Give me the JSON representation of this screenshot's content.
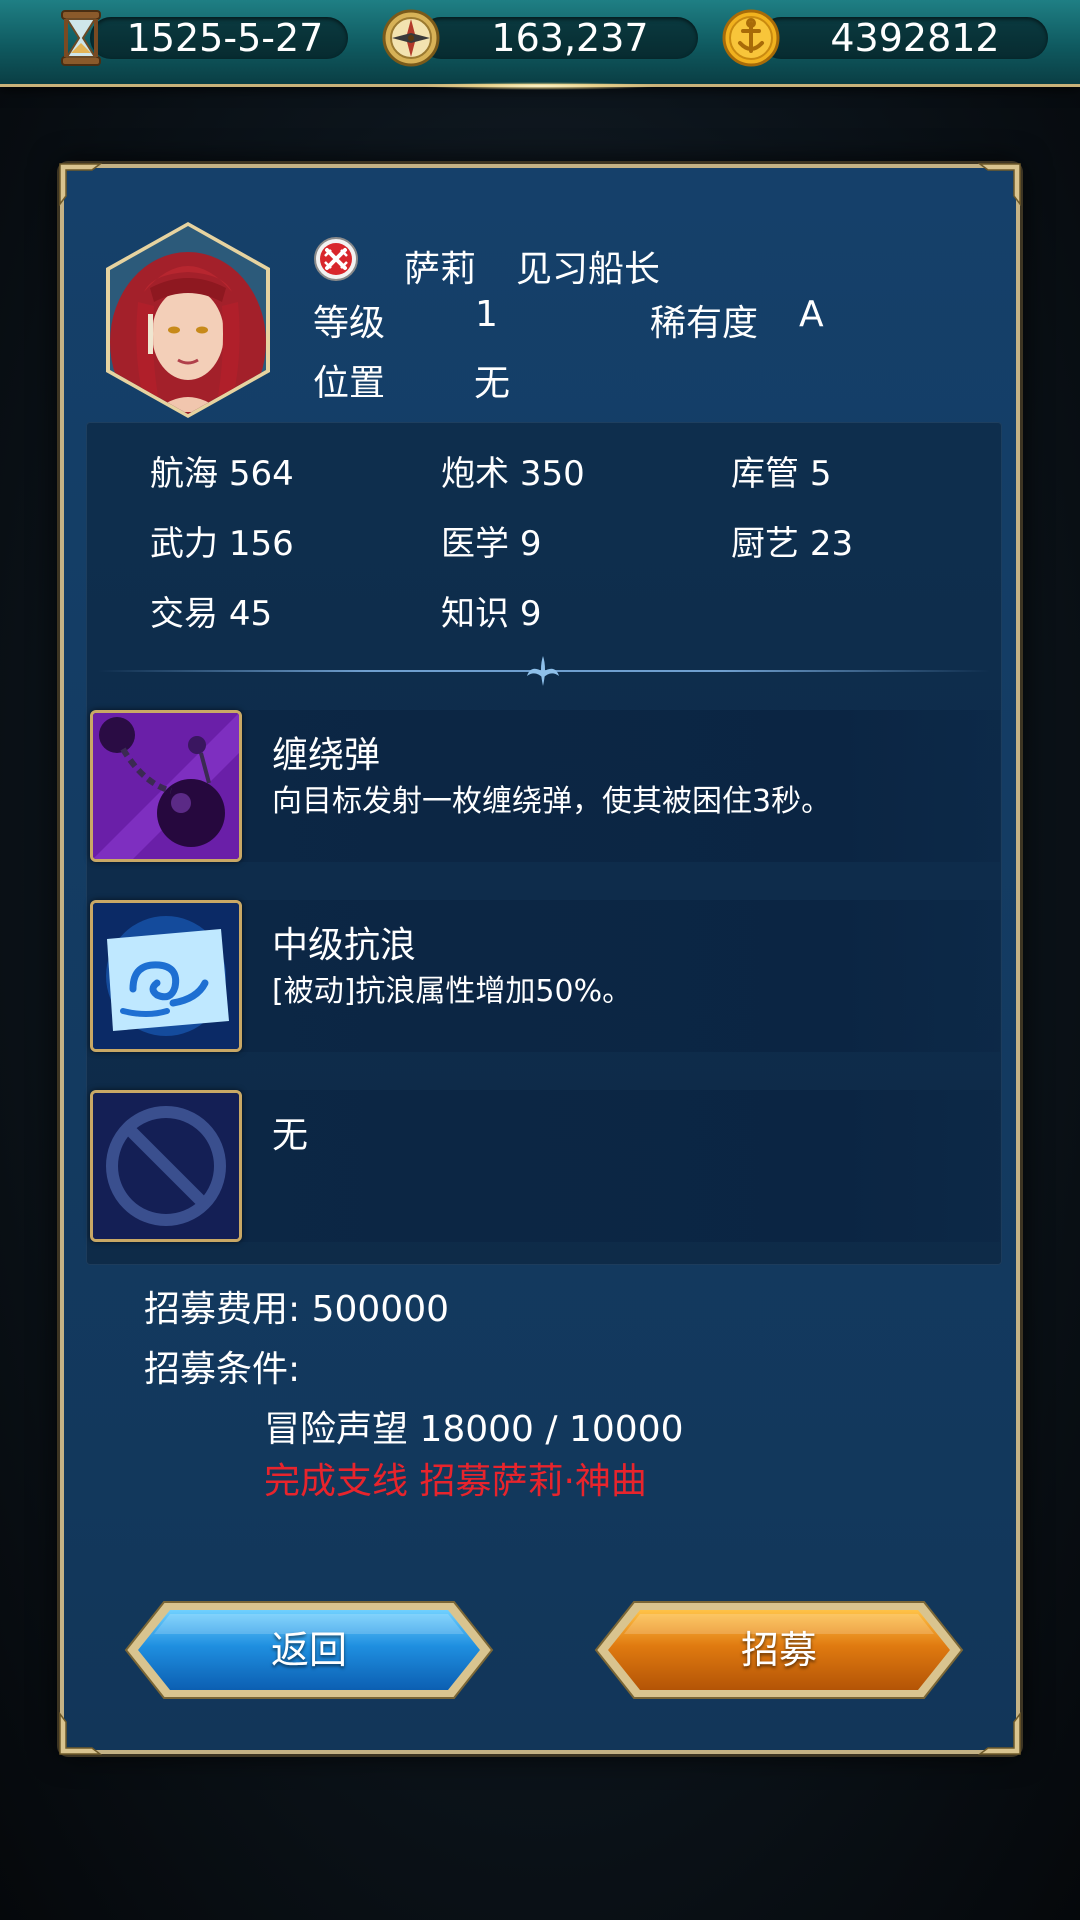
{
  "resources": {
    "date": "1525-5-27",
    "date_icon": "hourglass-icon",
    "compass_value": "163,237",
    "compass_icon": "compass-icon",
    "gold_value": "4392812",
    "gold_icon": "anchor-coin-icon"
  },
  "officer": {
    "name": "萨莉",
    "title": "见习船长",
    "level_label": "等级",
    "level_value": "1",
    "rarity_label": "稀有度",
    "rarity_value": "A",
    "position_label": "位置",
    "position_value": "无",
    "status_icon": "crossed-swords-red-icon"
  },
  "stats": [
    {
      "label": "航海",
      "value": "564"
    },
    {
      "label": "炮术",
      "value": "350"
    },
    {
      "label": "库管",
      "value": "5"
    },
    {
      "label": "武力",
      "value": "156"
    },
    {
      "label": "医学",
      "value": "9"
    },
    {
      "label": "厨艺",
      "value": "23"
    },
    {
      "label": "交易",
      "value": "45"
    },
    {
      "label": "知识",
      "value": "9"
    }
  ],
  "skills": [
    {
      "name": "缠绕弹",
      "desc": "向目标发射一枚缠绕弹，使其被困住3秒。",
      "icon": "chain-shot-icon"
    },
    {
      "name": "中级抗浪",
      "desc": "[被动]抗浪属性增加50%。",
      "icon": "wave-resist-icon"
    },
    {
      "name": "无",
      "desc": "",
      "icon": "empty-slot-icon"
    }
  ],
  "recruit": {
    "cost_label": "招募费用: 500000",
    "condition_label": "招募条件:",
    "condition_1": "冒险声望 18000 / 10000",
    "condition_2": "完成支线 招募萨莉·神曲",
    "condition_2_color": "#e8242c"
  },
  "buttons": {
    "back": "返回",
    "recruit": "招募"
  }
}
